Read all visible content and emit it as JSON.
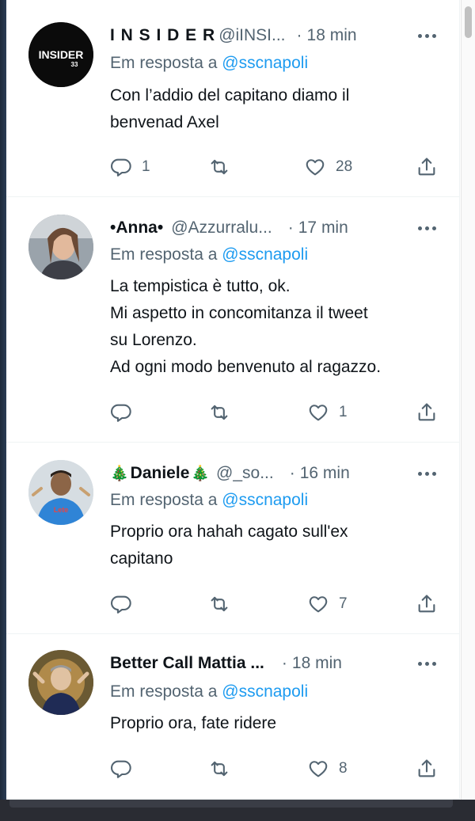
{
  "tweets": [
    {
      "name": "I N S I D E R",
      "handle": "@iINSI...",
      "time": "18 min",
      "reply_label": "Em resposta a",
      "reply_mention": "@sscnapoli",
      "lines": [
        "Con l’addio del capitano diamo il",
        "benvenad Axel"
      ],
      "reply_count": "1",
      "retweet_count": "",
      "like_count": "28",
      "avatar_text": "INSIDER",
      "avatar_sub": "33"
    },
    {
      "name": "•Anna•",
      "handle": "@Azzurralu...",
      "time": "17 min",
      "reply_label": "Em resposta a",
      "reply_mention": "@sscnapoli",
      "lines": [
        "La tempistica è tutto, ok.",
        "Mi aspetto in concomitanza il tweet",
        "su Lorenzo.",
        "Ad ogni modo benvenuto al ragazzo."
      ],
      "reply_count": "",
      "retweet_count": "",
      "like_count": "1"
    },
    {
      "name": "Daniele",
      "name_prefix": "🎄",
      "name_suffix": "🎄",
      "handle": "@_so...",
      "time": "16 min",
      "reply_label": "Em resposta a",
      "reply_mention": "@sscnapoli",
      "lines": [
        "Proprio ora hahah cagato sull'ex",
        "capitano"
      ],
      "reply_count": "",
      "retweet_count": "",
      "like_count": "7"
    },
    {
      "name": "Better Call Mattia ...",
      "handle": "",
      "time": "18 min",
      "reply_label": "Em resposta a",
      "reply_mention": "@sscnapoli",
      "lines": [
        "Proprio ora, fate ridere"
      ],
      "reply_count": "",
      "retweet_count": "",
      "like_count": "8"
    }
  ],
  "separator": "·",
  "icons": {
    "reply": "reply-icon",
    "retweet": "retweet-icon",
    "like": "like-icon",
    "share": "share-icon",
    "more": "more-icon"
  },
  "colors": {
    "text": "#0f1419",
    "secondary": "#536471",
    "accent": "#1d9bf0",
    "border": "#eff3f4"
  }
}
